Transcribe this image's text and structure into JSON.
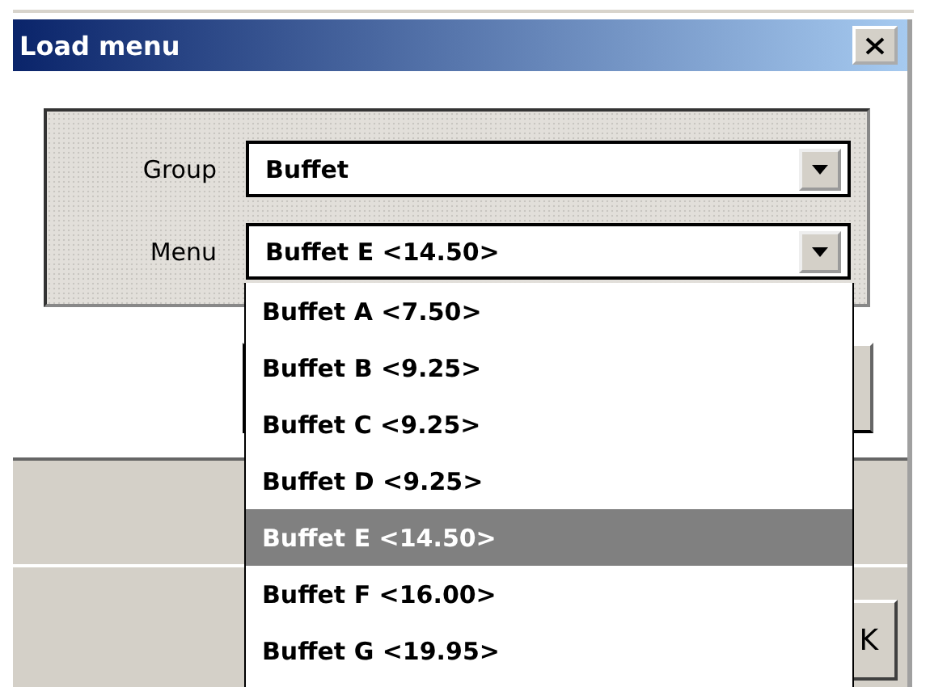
{
  "window": {
    "title": "Load menu"
  },
  "group": {
    "label": "Group",
    "value": "Buffet"
  },
  "menu": {
    "label": "Menu",
    "value": "Buffet E <14.50>",
    "expanded": true,
    "options": [
      {
        "label": "Buffet A <7.50>",
        "selected": false
      },
      {
        "label": "Buffet B <9.25>",
        "selected": false
      },
      {
        "label": "Buffet C <9.25>",
        "selected": false
      },
      {
        "label": "Buffet D <9.25>",
        "selected": false
      },
      {
        "label": "Buffet E <14.50>",
        "selected": true
      },
      {
        "label": "Buffet F <16.00>",
        "selected": false
      },
      {
        "label": "Buffet G <19.95>",
        "selected": false
      }
    ]
  },
  "ok_button": {
    "label": "K"
  }
}
